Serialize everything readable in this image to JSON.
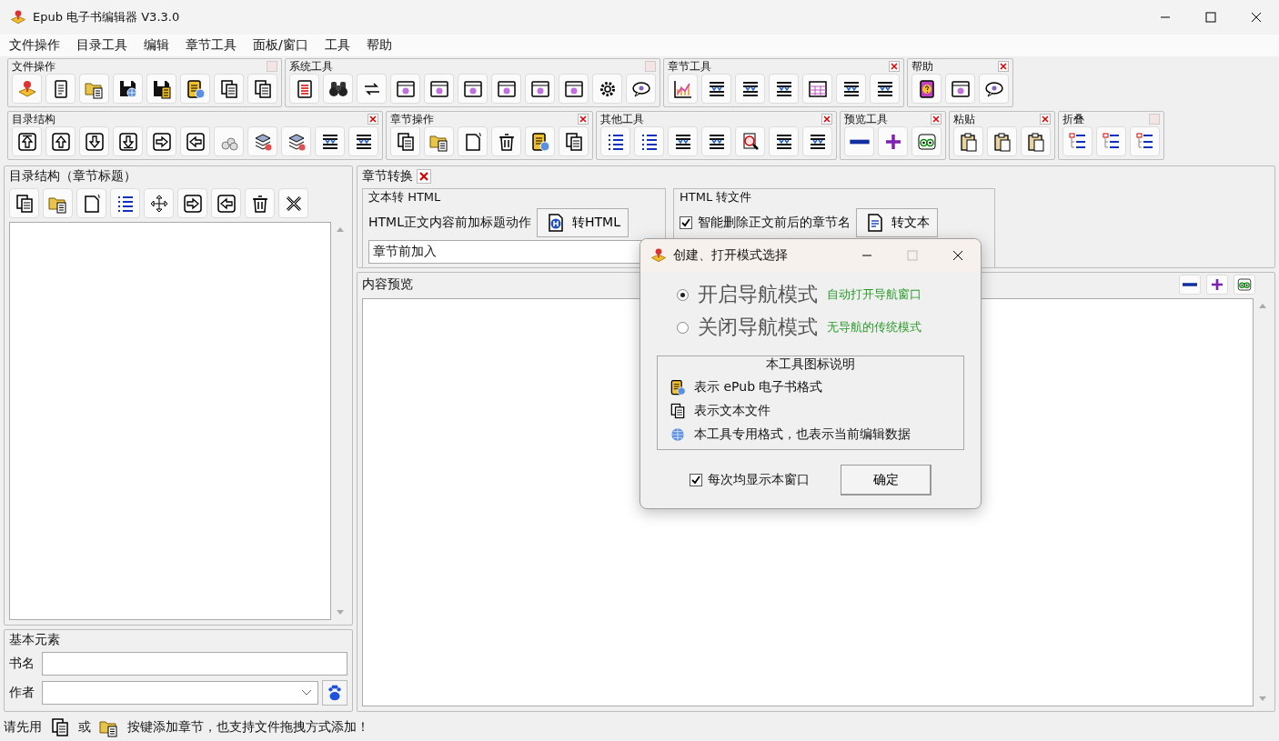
{
  "window": {
    "title": "Epub 电子书编辑器 V3.3.0"
  },
  "menu": [
    "文件操作",
    "目录工具",
    "编辑",
    "章节工具",
    "面板/窗口",
    "工具",
    "帮助"
  ],
  "toolbar_rows": [
    {
      "groups": [
        {
          "title": "文件操作",
          "closable": false,
          "buttons": [
            {
              "kind": "marker"
            },
            {
              "kind": "notes"
            },
            {
              "kind": "folder"
            },
            {
              "kind": "save"
            },
            {
              "kind": "savedoc"
            },
            {
              "kind": "epub"
            },
            {
              "kind": "docs"
            },
            {
              "kind": "docs"
            }
          ]
        },
        {
          "title": "系统工具",
          "closable": false,
          "buttons": [
            {
              "kind": "reddoc"
            },
            {
              "kind": "binoculars"
            },
            {
              "kind": "swap"
            },
            {
              "kind": "window"
            },
            {
              "kind": "window"
            },
            {
              "kind": "window"
            },
            {
              "kind": "window"
            },
            {
              "kind": "window"
            },
            {
              "kind": "window"
            },
            {
              "kind": "gear"
            },
            {
              "kind": "speech"
            }
          ]
        },
        {
          "title": "章节工具",
          "closable": true,
          "buttons": [
            {
              "kind": "chart"
            },
            {
              "kind": "lines"
            },
            {
              "kind": "lines"
            },
            {
              "kind": "lines"
            },
            {
              "kind": "table"
            },
            {
              "kind": "lines"
            },
            {
              "kind": "lines"
            }
          ]
        },
        {
          "title": "帮助",
          "closable": true,
          "buttons": [
            {
              "kind": "help"
            },
            {
              "kind": "window"
            },
            {
              "kind": "speech"
            }
          ]
        }
      ]
    },
    {
      "groups": [
        {
          "title": "目录结构",
          "closable": true,
          "buttons": [
            {
              "kind": "top"
            },
            {
              "kind": "up"
            },
            {
              "kind": "down"
            },
            {
              "kind": "bottom"
            },
            {
              "kind": "right"
            },
            {
              "kind": "left"
            },
            {
              "kind": "stack"
            },
            {
              "kind": "layers"
            },
            {
              "kind": "layers"
            },
            {
              "kind": "lines"
            },
            {
              "kind": "lines"
            }
          ]
        },
        {
          "title": "章节操作",
          "closable": true,
          "buttons": [
            {
              "kind": "docs"
            },
            {
              "kind": "folder"
            },
            {
              "kind": "newdoc"
            },
            {
              "kind": "trash"
            },
            {
              "kind": "epub"
            },
            {
              "kind": "docs"
            }
          ]
        },
        {
          "title": "其他工具",
          "closable": true,
          "buttons": [
            {
              "kind": "bluelist"
            },
            {
              "kind": "bluelist"
            },
            {
              "kind": "lines"
            },
            {
              "kind": "lines"
            },
            {
              "kind": "magnify"
            },
            {
              "kind": "lines"
            },
            {
              "kind": "lines"
            }
          ]
        },
        {
          "title": "预览工具",
          "closable": true,
          "buttons": [
            {
              "kind": "minus"
            },
            {
              "kind": "plus"
            },
            {
              "kind": "eyes"
            }
          ]
        },
        {
          "title": "粘贴",
          "closable": true,
          "buttons": [
            {
              "kind": "clipboard"
            },
            {
              "kind": "clipboard"
            },
            {
              "kind": "clipboard"
            }
          ]
        },
        {
          "title": "折叠",
          "closable": false,
          "buttons": [
            {
              "kind": "fold"
            },
            {
              "kind": "fold"
            },
            {
              "kind": "fold"
            }
          ]
        }
      ]
    }
  ],
  "outline": {
    "title": "目录结构（章节标题）",
    "buttons": [
      {
        "kind": "docs"
      },
      {
        "kind": "folder"
      },
      {
        "kind": "newdoc"
      },
      {
        "kind": "bluelist"
      },
      {
        "kind": "move"
      },
      {
        "kind": "right"
      },
      {
        "kind": "left"
      },
      {
        "kind": "trash"
      },
      {
        "kind": "tools"
      }
    ]
  },
  "basic": {
    "title": "基本元素",
    "fields": [
      {
        "label": "书名",
        "kind": "text"
      },
      {
        "label": "作者",
        "kind": "combo"
      }
    ]
  },
  "convert": {
    "title": "章节转换",
    "text_to_html": {
      "title": "文本转 HTML",
      "label": "HTML正文内容前加标题动作",
      "button": "转HTML",
      "select": "章节前加入"
    },
    "html_to_file": {
      "title": "HTML 转文件",
      "checkbox": {
        "label": "智能删除正文前后的章节名",
        "checked": true
      },
      "button": "转文本"
    }
  },
  "preview": {
    "title": "内容预览",
    "buttons": [
      {
        "kind": "minus"
      },
      {
        "kind": "plus"
      },
      {
        "kind": "eyes"
      }
    ]
  },
  "status": [
    {
      "kind": "text",
      "text": "请先用"
    },
    {
      "kind": "docs"
    },
    {
      "kind": "text",
      "text": "或"
    },
    {
      "kind": "folder"
    },
    {
      "kind": "text",
      "text": "按键添加章节，也支持文件拖拽方式添加！"
    }
  ],
  "dialog": {
    "title": "创建、打开模式选择",
    "modes": [
      {
        "label": "开启导航模式",
        "note": "自动打开导航窗口",
        "selected": true
      },
      {
        "label": "关闭导航模式",
        "note": "无导航的传统模式",
        "selected": false
      }
    ],
    "legend": {
      "title": "本工具图标说明",
      "items": [
        {
          "kind": "epub",
          "text": "表示 ePub 电子书格式"
        },
        {
          "kind": "docs",
          "text": "表示文本文件"
        },
        {
          "kind": "globe",
          "text": "本工具专用格式，也表示当前编辑数据"
        }
      ]
    },
    "checkbox": {
      "label": "每次均显示本窗口",
      "checked": true
    },
    "button": "确定"
  }
}
